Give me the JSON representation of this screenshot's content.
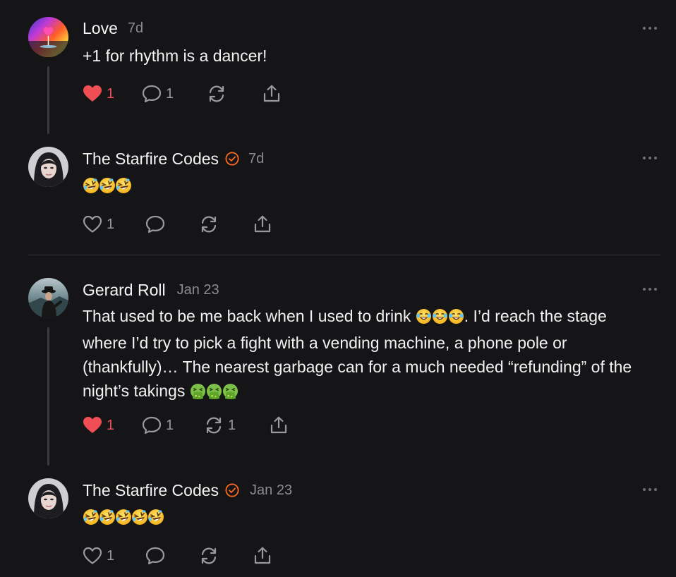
{
  "colors": {
    "background": "#151517",
    "liked": "#f04e55",
    "verified": "#ff6a1f",
    "muted": "#8c8c90"
  },
  "comments": [
    {
      "author": "Love",
      "verified": false,
      "time": "7d",
      "text": "+1 for rhythm is a dancer!",
      "avatar_icon": "rainbow-heart-avatar",
      "liked": true,
      "likes": "1",
      "replies": "1",
      "restacks": ""
    },
    {
      "author": "The Starfire Codes",
      "verified": true,
      "time": "7d",
      "emoji": "🤣🤣🤣",
      "avatar_icon": "woman-portrait-avatar",
      "liked": false,
      "likes": "1",
      "replies": "",
      "restacks": ""
    },
    {
      "author": "Gerard Roll",
      "verified": false,
      "time": "Jan 23",
      "text_parts": [
        "That used to be me back when I used to drink ",
        ". I’d reach the stage where I’d try to pick a fight with a vending machine, a phone pole or (thankfully)… The nearest garbage can for a much needed “refunding” of the night’s takings "
      ],
      "emoji_1": "😂😂😂",
      "emoji_2": "🤮🤮🤮",
      "avatar_icon": "man-in-hat-avatar",
      "liked": true,
      "likes": "1",
      "replies": "1",
      "restacks": "1"
    },
    {
      "author": "The Starfire Codes",
      "verified": true,
      "time": "Jan 23",
      "emoji": "🤣🤣🤣🤣🤣",
      "avatar_icon": "woman-portrait-avatar",
      "liked": false,
      "likes": "1",
      "replies": "",
      "restacks": ""
    }
  ]
}
